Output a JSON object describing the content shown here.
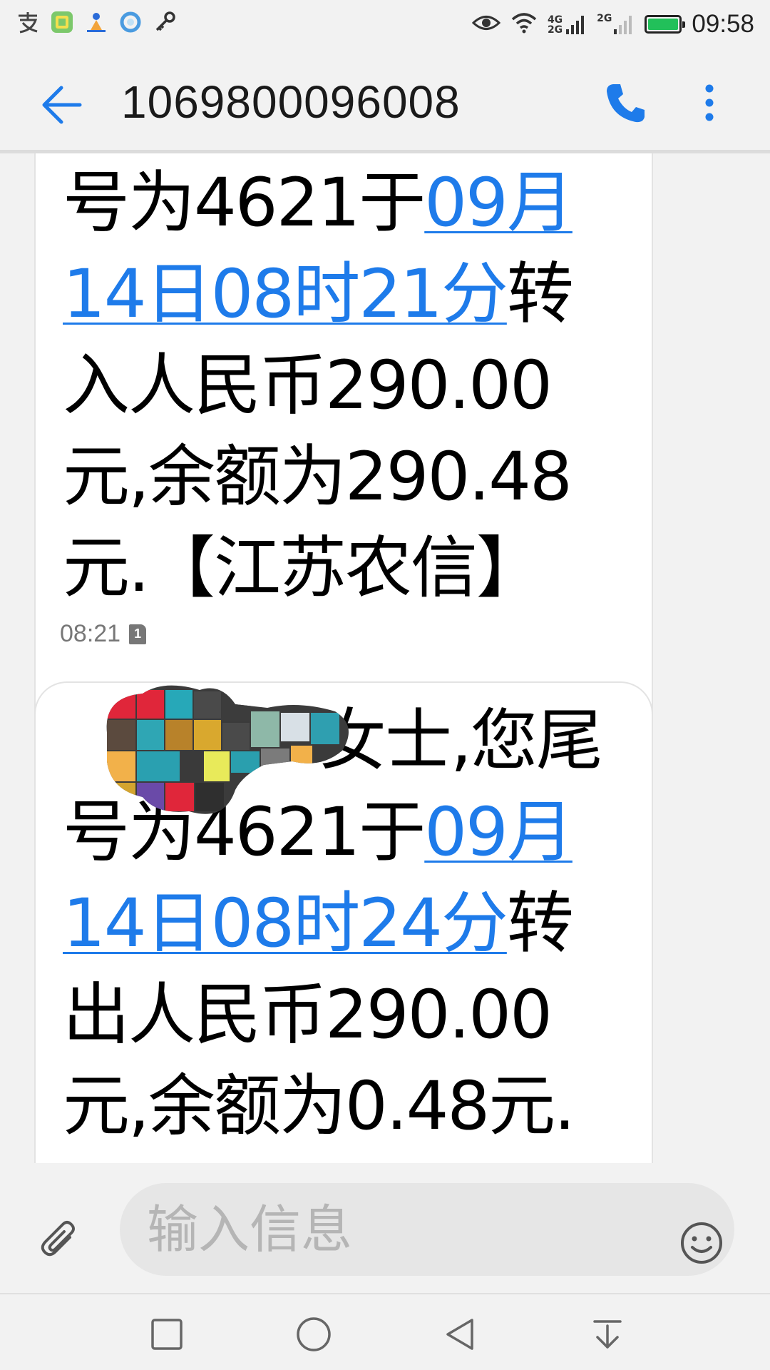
{
  "status_bar": {
    "time": "09:58",
    "net1": "4G",
    "net2": "2G",
    "net3": "2G",
    "app_icons": [
      "alipay-icon",
      "app-green-icon",
      "app-blue-icon",
      "app-circle-icon",
      "key-icon"
    ],
    "battery_level": 0.9,
    "battery_color": "#22c05a"
  },
  "header": {
    "title": "1069800096008"
  },
  "messages": [
    {
      "lines": [
        {
          "text": "号为4621于",
          "link": "09月"
        },
        {
          "link": "14日08时21分",
          "text": "转"
        },
        {
          "text": "入人民币290.00"
        },
        {
          "text": "元,余额为290.48"
        },
        {
          "text": "元.【江苏农信】"
        }
      ],
      "time": "08:21",
      "sim": "1"
    },
    {
      "lines": [
        {
          "text": "女士,您尾"
        },
        {
          "text": "号为4621于",
          "link": "09月"
        },
        {
          "link": "14日08时24分",
          "text": "转"
        },
        {
          "text": "出人民币290.00"
        },
        {
          "text": "元,余额为0.48元."
        }
      ]
    }
  ],
  "compose": {
    "placeholder": "输入信息"
  },
  "colors": {
    "accent": "#1e7bea",
    "background": "#f2f2f2",
    "bubble": "#ffffff"
  }
}
